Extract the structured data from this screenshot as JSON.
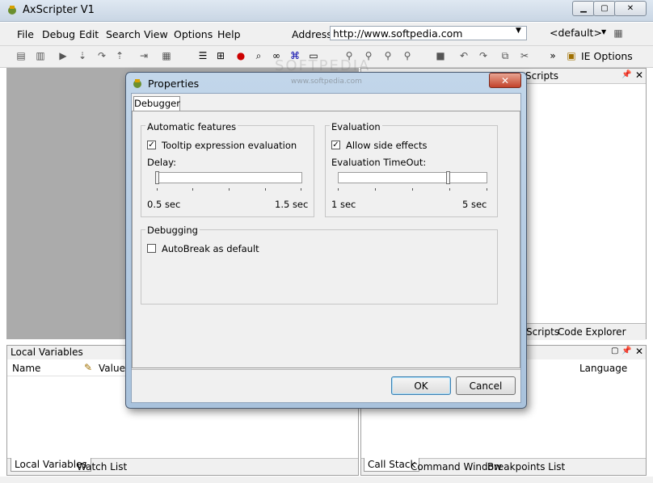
{
  "app": {
    "title": "AxScripter V1"
  },
  "menu": [
    "File",
    "Debug",
    "Edit",
    "Search",
    "View",
    "Options",
    "Help"
  ],
  "address": {
    "label": "Address",
    "value": "http://www.softpedia.com"
  },
  "toolbar": {
    "default_select": "<default>",
    "ie_options": "IE Options"
  },
  "right_panel": {
    "title": "Scripts",
    "tabs": [
      "Scripts",
      "Code Explorer"
    ]
  },
  "locals": {
    "title": "Local Variables",
    "columns": [
      "Name",
      "Value"
    ],
    "tabs": [
      "Local Variables",
      "Watch List"
    ]
  },
  "callstack": {
    "columns": [
      "Language"
    ],
    "tabs": [
      "Call Stack",
      "Command Window",
      "Breakpoints List"
    ]
  },
  "watermark": {
    "text": "SOFTPEDIA",
    "url": "www.softpedia.com"
  },
  "dialog": {
    "title": "Properties",
    "tab": "Debugger",
    "automatic": {
      "title": "Automatic features",
      "tooltip_label": "Tooltip expression evaluation",
      "tooltip_checked": true,
      "delay_label": "Delay:",
      "delay_min": "0.5 sec",
      "delay_max": "1.5 sec",
      "delay_value": 0.0
    },
    "evaluation": {
      "title": "Evaluation",
      "side_effects_label": "Allow side effects",
      "side_effects_checked": true,
      "timeout_label": "Evaluation TimeOut:",
      "timeout_min": "1 sec",
      "timeout_max": "5 sec",
      "timeout_value": 0.75
    },
    "debugging": {
      "title": "Debugging",
      "autobreak_label": "AutoBreak as default",
      "autobreak_checked": false
    },
    "ok": "OK",
    "cancel": "Cancel"
  },
  "colors": {
    "titlebar": "#c9d6e4",
    "close": "#c3422a",
    "workspace": "#ababab"
  }
}
